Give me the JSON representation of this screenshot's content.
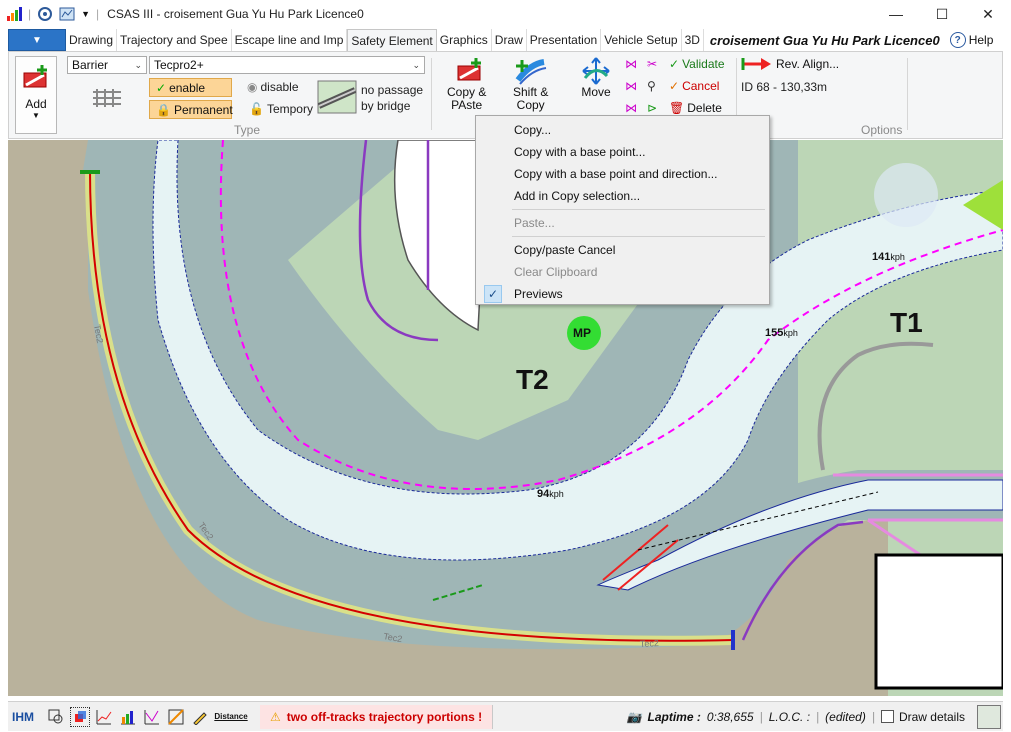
{
  "titlebar": {
    "app_title": "CSAS III - croisement Gua Yu Hu Park Licence0",
    "minimize": "—",
    "maximize": "☐",
    "close": "✕"
  },
  "tabs": [
    {
      "label": "Drawing",
      "active": false
    },
    {
      "label": "Trajectory and Spee",
      "active": false
    },
    {
      "label": "Escape line and Imp",
      "active": false
    },
    {
      "label": "Safety Element",
      "active": true
    },
    {
      "label": "Graphics",
      "active": false
    },
    {
      "label": "Draw",
      "active": false
    },
    {
      "label": "Presentation",
      "active": false
    },
    {
      "label": "Vehicle Setup",
      "active": false
    },
    {
      "label": "3D",
      "active": false
    }
  ],
  "doc_title": "croisement Gua Yu Hu Park Licence0",
  "help_label": "Help",
  "ribbon": {
    "add_label": "Add",
    "element_type": "Barrier",
    "element_model": "Tecpro2+",
    "enable_label": "enable",
    "disable_label": "disable",
    "permanent_label": "Permanent",
    "temporary_label": "Tempory",
    "no_passage_label_1": "no passage",
    "no_passage_label_2": "by bridge",
    "type_group_label": "Type",
    "copy_paste_label_1": "Copy &",
    "copy_paste_label_2": "PAste",
    "shift_copy_label_1": "Shift &",
    "shift_copy_label_2": "Copy",
    "move_label": "Move",
    "validate_label": "Validate",
    "cancel_label": "Cancel",
    "delete_label": "Delete",
    "rev_align_label": "Rev.  Align...",
    "id_info": "ID  68 - 130,33m",
    "options_group_label": "Options"
  },
  "context_menu": {
    "items": [
      {
        "label": "Copy...",
        "enabled": true
      },
      {
        "label": "Copy with a base point...",
        "enabled": true
      },
      {
        "label": "Copy with a base point and direction...",
        "enabled": true
      },
      {
        "label": "Add in Copy selection...",
        "enabled": true
      },
      {
        "label": "Paste...",
        "enabled": false
      },
      {
        "label": "Copy/paste Cancel",
        "enabled": true
      },
      {
        "label": "Clear Clipboard",
        "enabled": false
      },
      {
        "label": "Previews",
        "enabled": true,
        "checked": true
      }
    ]
  },
  "map": {
    "corner_t1": "T1",
    "corner_t2": "T2",
    "marker_mp": "MP",
    "speed_141": "141",
    "speed_155": "155",
    "speed_94": "94",
    "speed_unit": "kph",
    "barrier_label": "Tec2"
  },
  "statusbar": {
    "ihm": "IHM",
    "distance_icon_label": "Distance",
    "warning": "two off-tracks trajectory portions !",
    "laptime_label": "Laptime :",
    "laptime_value": "0:38,655",
    "loc_label": "L.O.C. :",
    "edited_label": "(edited)",
    "draw_details_label": "Draw details"
  },
  "colors": {
    "accent_blue": "#2b74c7",
    "chip_orange": "#fcd597",
    "barrier_red": "#d40000",
    "barrier_yellow": "#d9e08a",
    "speed_line": "#ff00ff",
    "gravel": "#b9b29c",
    "grass": "#bcd6b6",
    "track": "#e6f3f4",
    "marker_green": "#33dd33"
  }
}
